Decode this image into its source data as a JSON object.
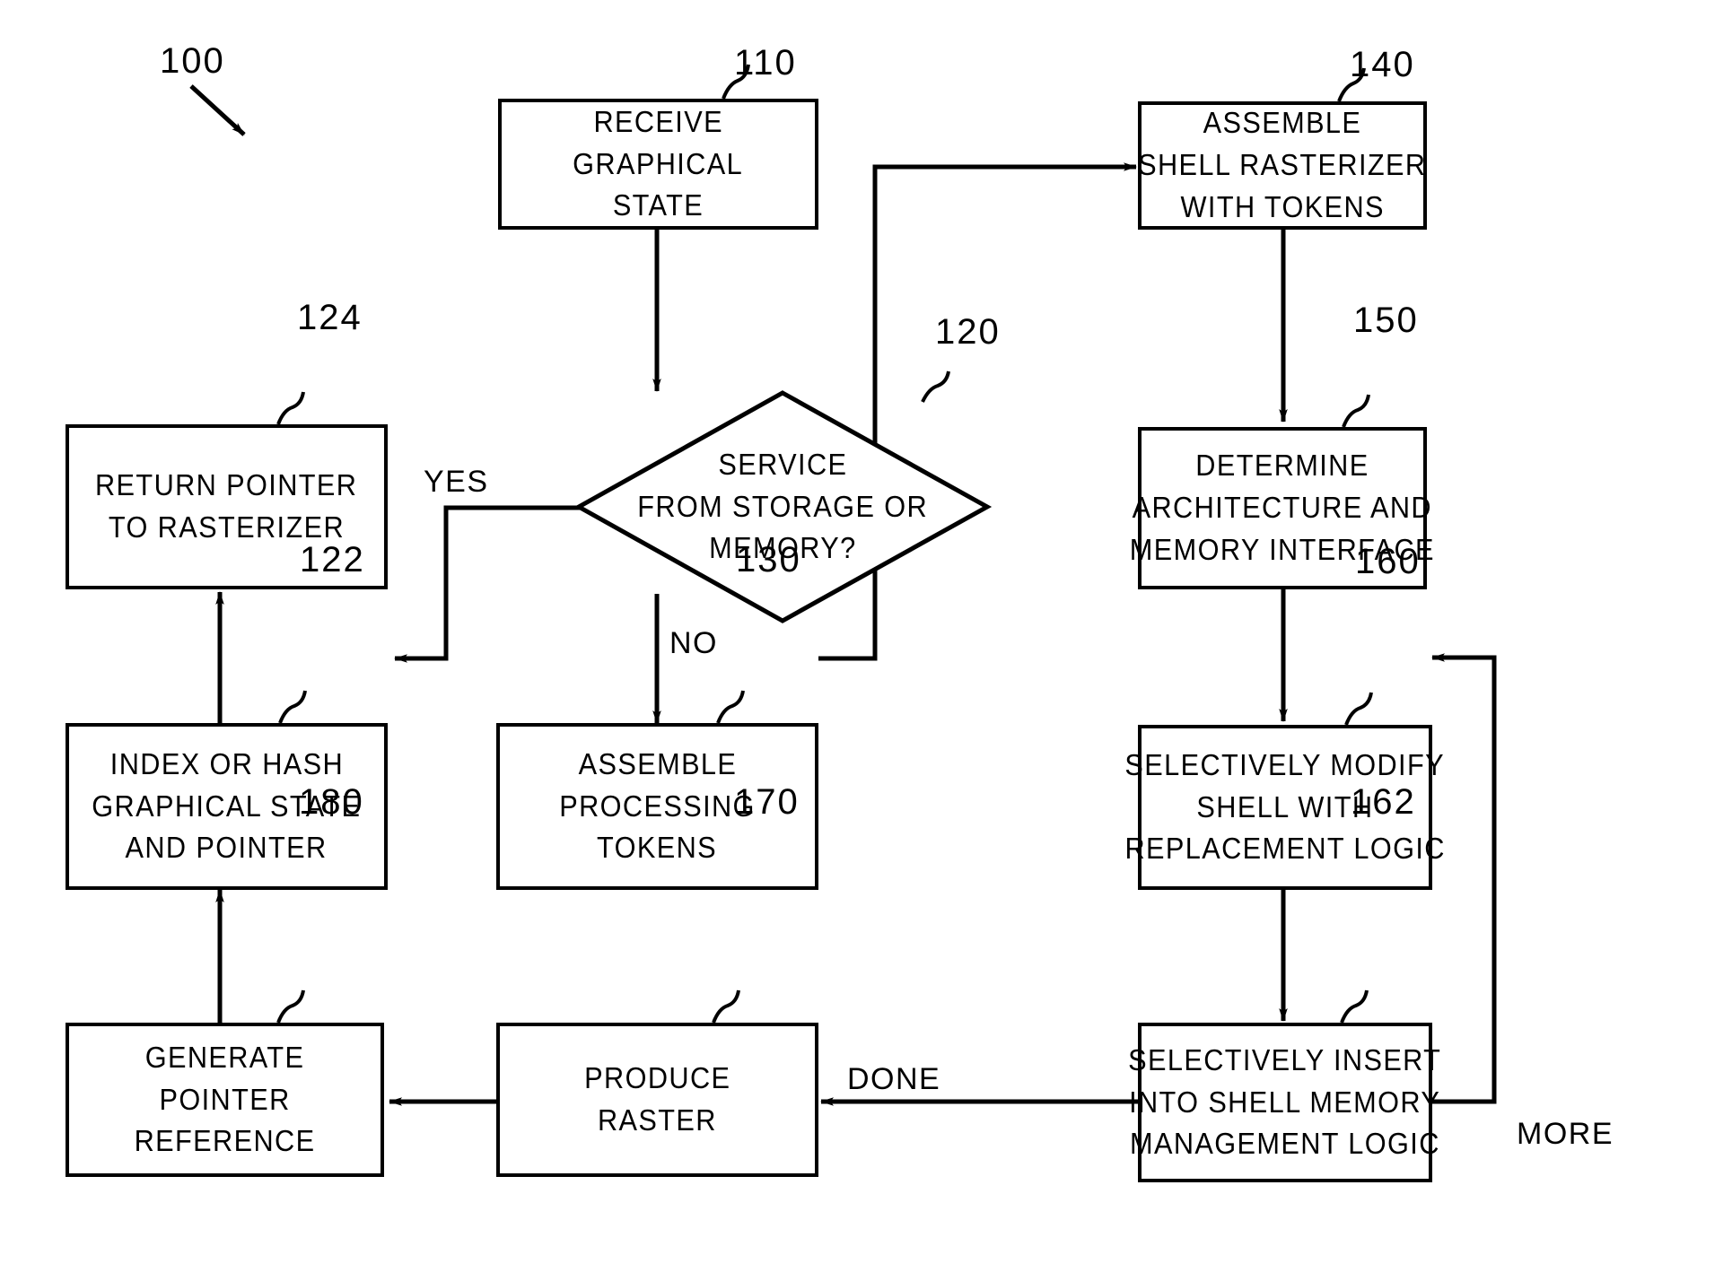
{
  "figure": {
    "ref_label": "100"
  },
  "nodes": [
    {
      "id": "110",
      "name": "receive-graphical-state",
      "ref": "110",
      "lines": [
        "RECEIVE",
        "GRAPHICAL",
        "STATE"
      ]
    },
    {
      "id": "140",
      "name": "assemble-shell-rasterizer-with-tokens",
      "ref": "140",
      "lines": [
        "ASSEMBLE",
        "SHELL RASTERIZER",
        "WITH TOKENS"
      ]
    },
    {
      "id": "124",
      "name": "return-pointer-to-rasterizer",
      "ref": "124",
      "lines": [
        "RETURN  POINTER",
        "TO  RASTERIZER"
      ]
    },
    {
      "id": "150",
      "name": "determine-architecture-and-memory-interface",
      "ref": "150",
      "lines": [
        "DETERMINE",
        "ARCHITECTURE AND",
        "MEMORY INTERFACE"
      ]
    },
    {
      "id": "122",
      "name": "index-or-hash-graphical-state-and-pointer",
      "ref": "122",
      "lines": [
        "INDEX OR HASH",
        "GRAPHICAL  STATE",
        "AND  POINTER"
      ]
    },
    {
      "id": "130",
      "name": "assemble-processing-tokens",
      "ref": "130",
      "lines": [
        "ASSEMBLE",
        "PROCESSING",
        "TOKENS"
      ]
    },
    {
      "id": "160",
      "name": "selectively-modify-shell-with-replacement-logic",
      "ref": "160",
      "lines": [
        "SELECTIVELY  MODIFY",
        "SHELL  WITH",
        "REPLACEMENT  LOGIC"
      ]
    },
    {
      "id": "180",
      "name": "generate-pointer-reference",
      "ref": "180",
      "lines": [
        "GENERATE",
        "POINTER",
        "REFERENCE"
      ]
    },
    {
      "id": "170",
      "name": "produce-raster",
      "ref": "170",
      "lines": [
        "PRODUCE",
        "RASTER"
      ]
    },
    {
      "id": "162",
      "name": "selectively-insert-into-shell-memory-management-logic",
      "ref": "162",
      "lines": [
        "SELECTIVELY INSERT",
        "INTO SHELL MEMORY",
        "MANAGEMENT LOGIC"
      ]
    }
  ],
  "decision": {
    "id": "120",
    "name": "service-from-storage-or-memory",
    "ref": "120",
    "lines": [
      "SERVICE",
      "FROM STORAGE OR",
      "MEMORY?"
    ]
  },
  "edge_labels": {
    "yes": "YES",
    "no": "NO",
    "done": "DONE",
    "more": "MORE"
  },
  "colors": {
    "stroke": "#000000",
    "background": "#ffffff"
  }
}
